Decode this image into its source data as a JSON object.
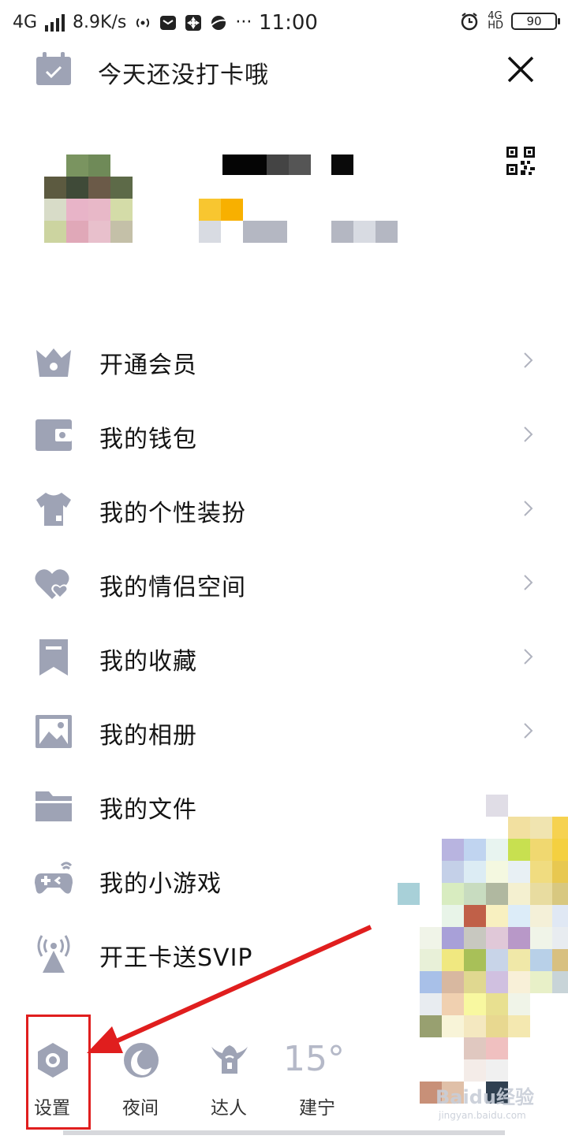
{
  "status_bar": {
    "network": "4G",
    "speed": "8.9K/s",
    "time": "11:00",
    "battery": "90",
    "network_right": "4G",
    "hd": "HD",
    "more": "···"
  },
  "header": {
    "checkin_text": "今天还没打卡哦"
  },
  "menu": {
    "items": [
      {
        "label": "开通会员",
        "icon": "crown-icon",
        "chevron": true
      },
      {
        "label": "我的钱包",
        "icon": "wallet-icon",
        "chevron": true
      },
      {
        "label": "我的个性装扮",
        "icon": "tshirt-icon",
        "chevron": true
      },
      {
        "label": "我的情侣空间",
        "icon": "hearts-icon",
        "chevron": true
      },
      {
        "label": "我的收藏",
        "icon": "bookmark-icon",
        "chevron": true
      },
      {
        "label": "我的相册",
        "icon": "image-icon",
        "chevron": true
      },
      {
        "label": "我的文件",
        "icon": "folder-icon",
        "chevron": false
      },
      {
        "label": "我的小游戏",
        "icon": "gamepad-icon",
        "chevron": false
      },
      {
        "label": "开王卡送SVIP",
        "icon": "signal-tower-icon",
        "chevron": false
      }
    ]
  },
  "bottom": {
    "settings": "设置",
    "night": "夜间",
    "expert": "达人",
    "temperature": "15°",
    "city": "建宁"
  },
  "watermark": {
    "brand": "Baidu经验",
    "url": "jingyan.baidu.com"
  },
  "colors": {
    "icon_gray": "#9ea3b5",
    "highlight_red": "#e01e1e",
    "text": "#141414"
  }
}
